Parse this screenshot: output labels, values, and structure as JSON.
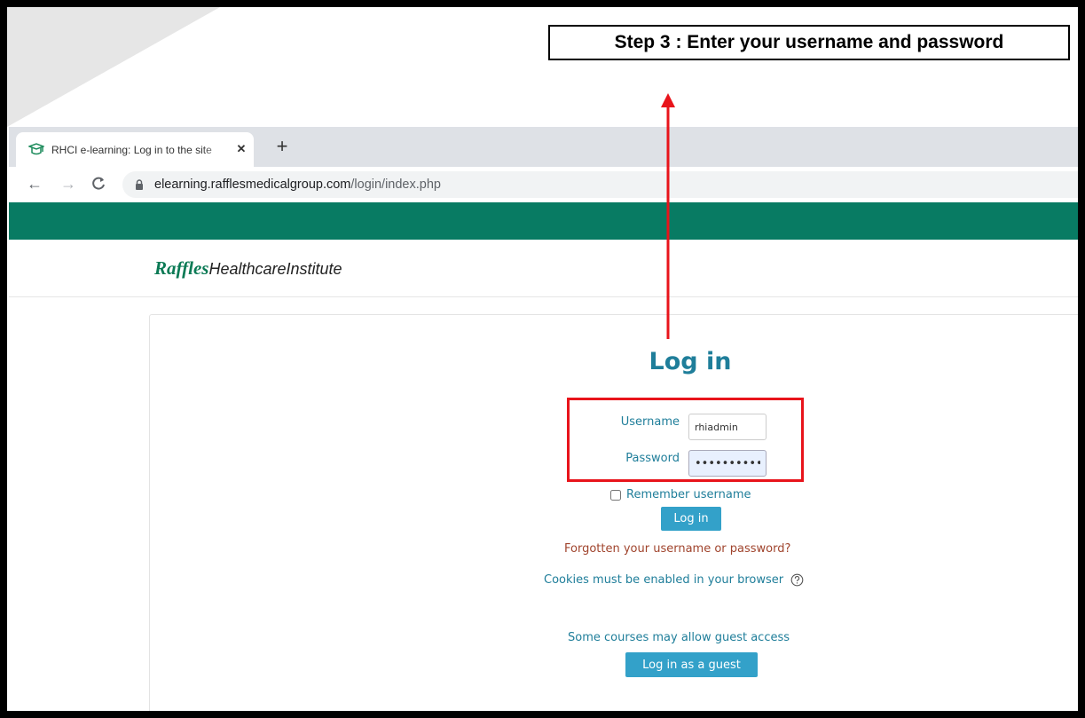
{
  "annotation": {
    "step_text": "Step 3 : Enter your username and password"
  },
  "browser": {
    "tab_title": "RHCI e-learning: Log in to the site",
    "url_host": "elearning.rafflesmedicalgroup.com",
    "url_path": "/login/index.php"
  },
  "site": {
    "logo_part1": "Raffles",
    "logo_part2": "HealthcareInstitute"
  },
  "login": {
    "title": "Log in",
    "username_label": "Username",
    "username_value": "rhiadmin",
    "password_label": "Password",
    "password_value": "•••••••••••",
    "remember_label": "Remember username",
    "login_button": "Log in",
    "forgot_link": "Forgotten your username or password?",
    "cookies_text": "Cookies must be enabled in your browser",
    "guest_text": "Some courses may allow guest access",
    "guest_button": "Log in as a guest"
  },
  "colors": {
    "accent": "#1f7e9a",
    "button": "#33a1c9",
    "header_green": "#087b63",
    "highlight_red": "#e8141b",
    "forgot_link": "#a0442d"
  }
}
